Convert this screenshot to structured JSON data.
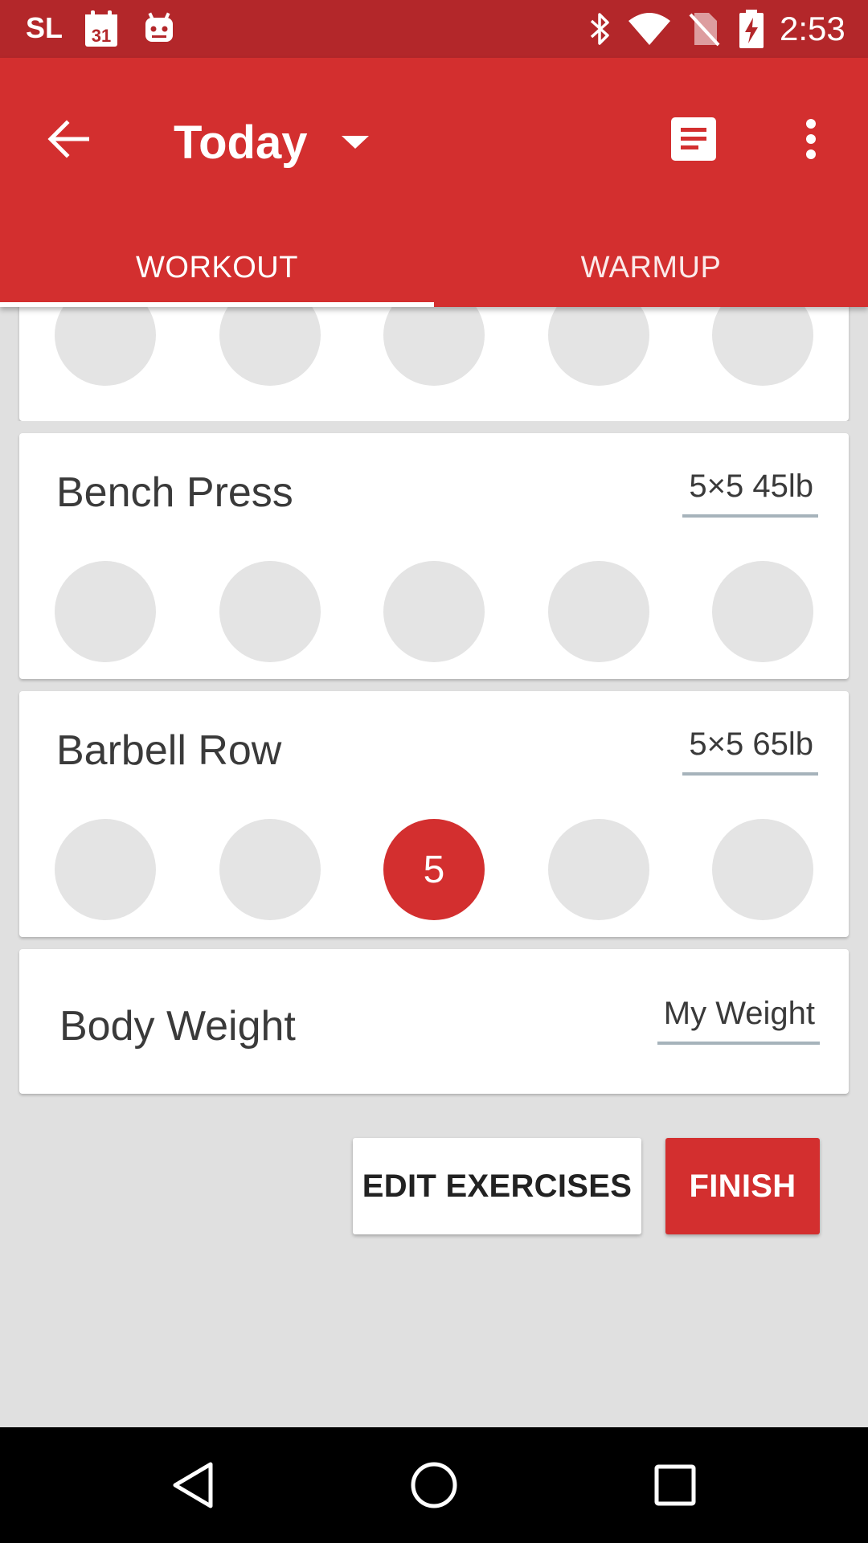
{
  "status_bar": {
    "carrier": "SL",
    "calendar_day": "31",
    "time": "2:53",
    "icons": [
      "calendar-icon",
      "android-icon",
      "bluetooth-icon",
      "wifi-icon",
      "no-sim-icon",
      "battery-charging-icon"
    ]
  },
  "app_bar": {
    "title": "Today",
    "color": "#d32f2f",
    "icons": [
      "back-arrow-icon",
      "dropdown-caret-icon",
      "notes-icon",
      "more-vert-icon"
    ]
  },
  "tabs": [
    {
      "label": "WORKOUT",
      "active": true
    },
    {
      "label": "WARMUP",
      "active": false
    }
  ],
  "exercises": {
    "previous": {
      "sets": [
        "",
        "",
        "",
        "",
        ""
      ]
    },
    "bench": {
      "name": "Bench Press",
      "weight": "5×5 45lb",
      "sets": [
        "",
        "",
        "",
        "",
        ""
      ]
    },
    "row": {
      "name": "Barbell Row",
      "weight": "5×5 65lb",
      "sets": [
        "",
        "",
        "5",
        "",
        ""
      ]
    }
  },
  "body_weight": {
    "label": "Body Weight",
    "value": "My Weight"
  },
  "buttons": {
    "edit": "EDIT EXERCISES",
    "finish": "FINISH"
  },
  "nav_bar": {
    "icons": [
      "nav-back-icon",
      "nav-home-icon",
      "nav-recents-icon"
    ]
  }
}
